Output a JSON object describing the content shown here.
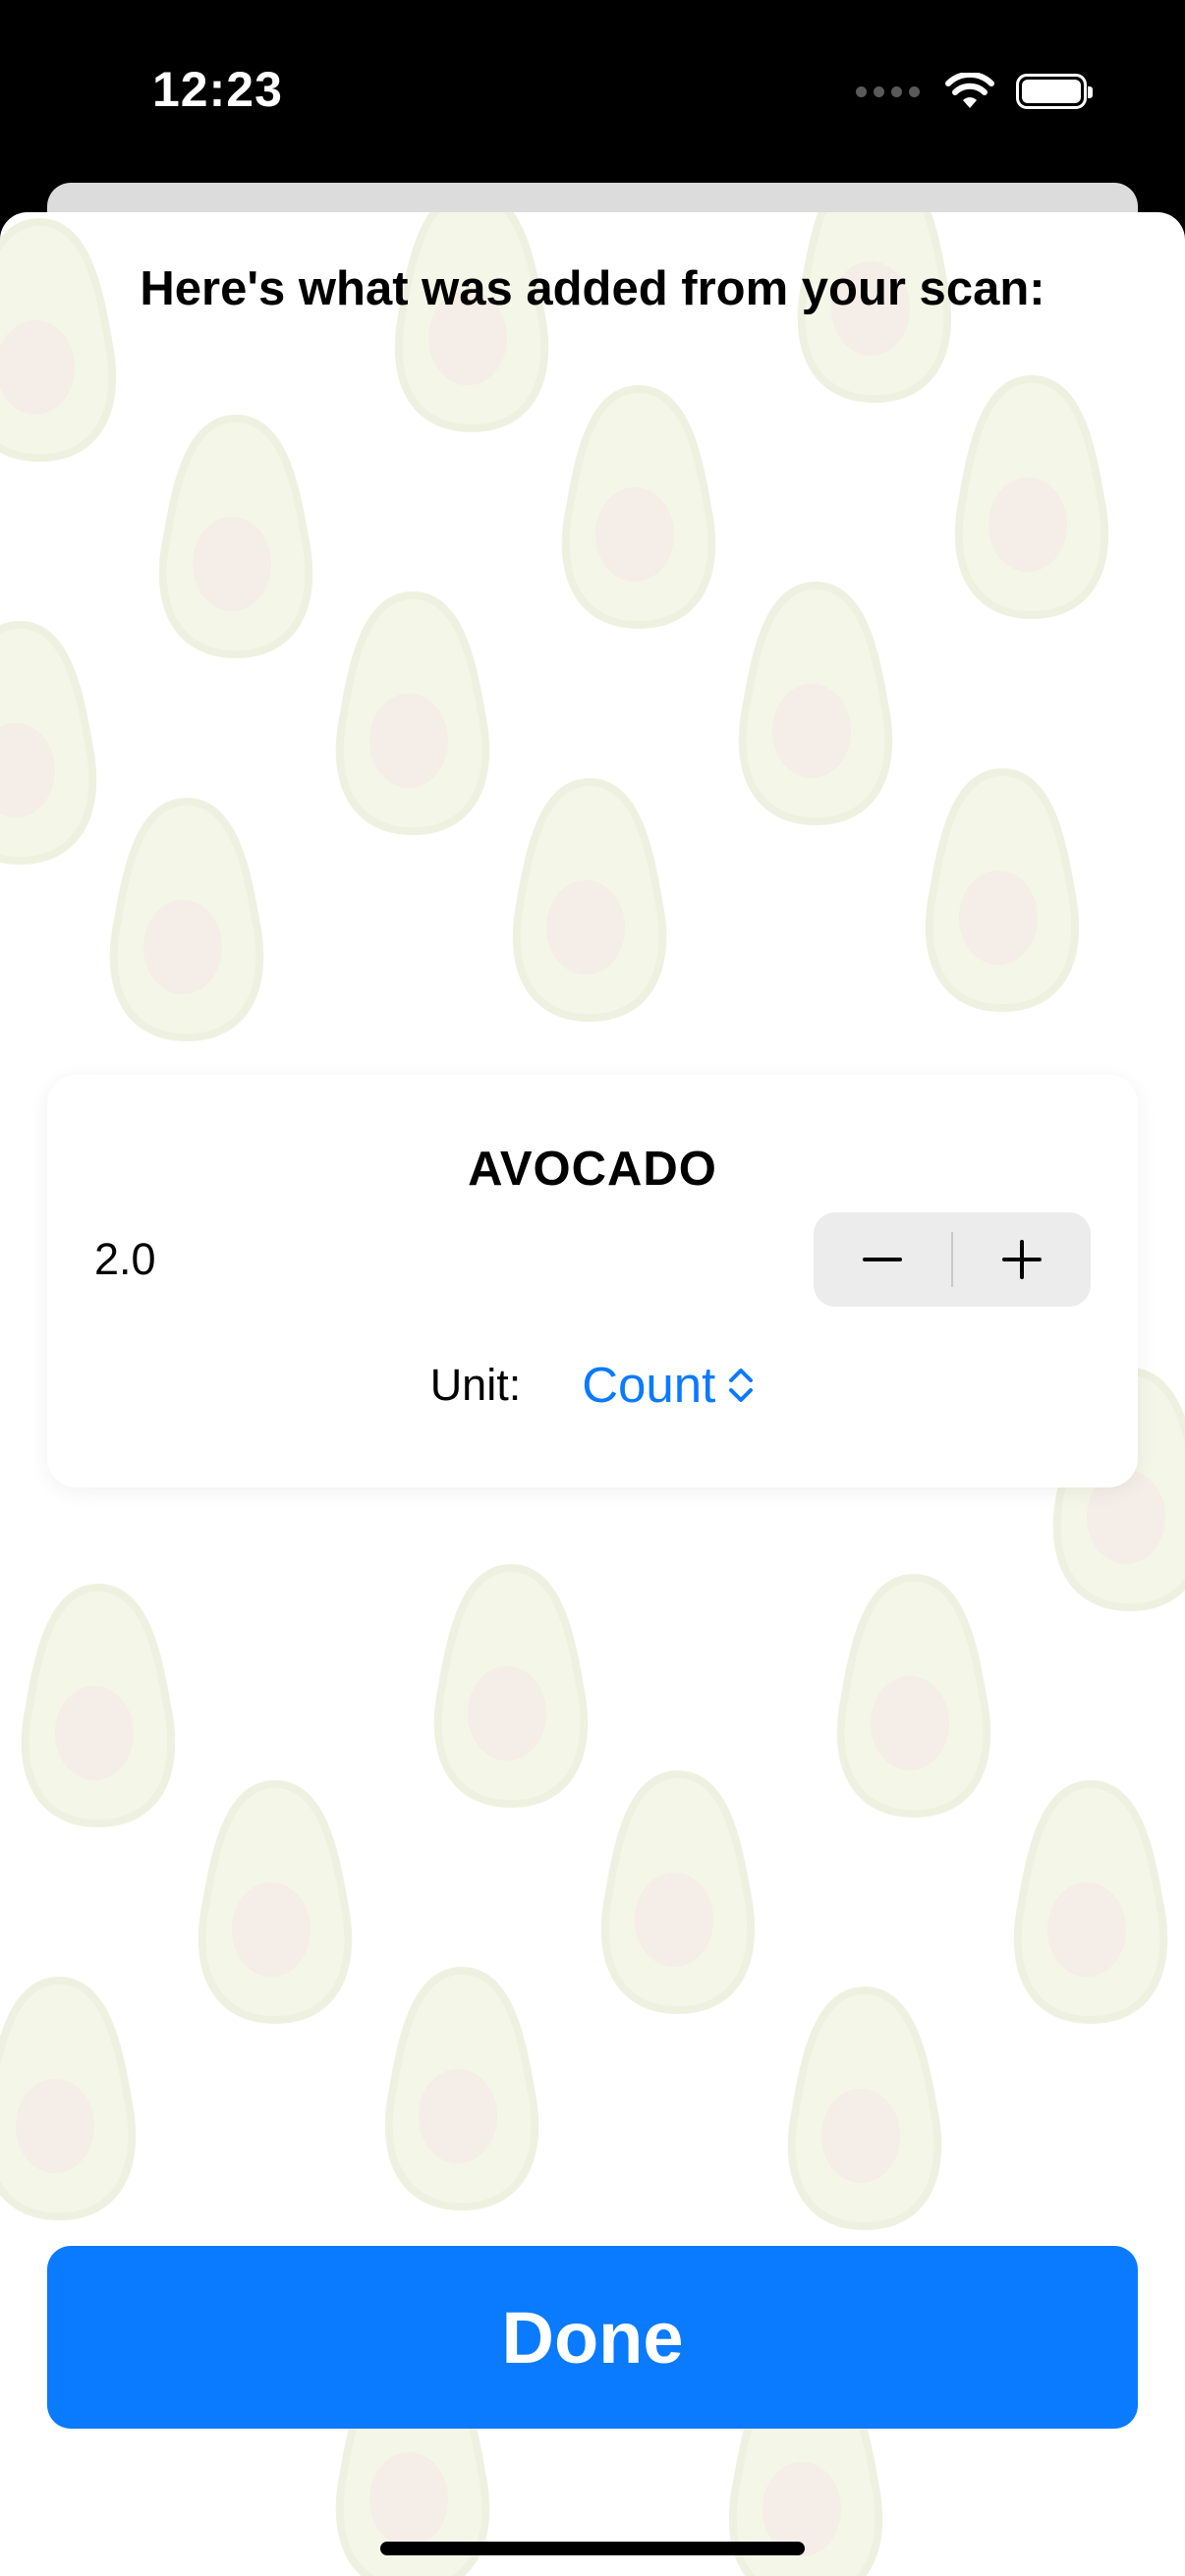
{
  "status_bar": {
    "time": "12:23",
    "icons": [
      "cellular-dots-icon",
      "wifi-icon",
      "battery-icon"
    ]
  },
  "sheet": {
    "title": "Here's what was added from your scan:",
    "background": "avocado-pattern"
  },
  "item": {
    "name": "AVOCADO",
    "quantity": "2.0",
    "unit_label": "Unit:",
    "unit_value": "Count",
    "stepper": {
      "decrement": "minus-icon",
      "increment": "plus-icon"
    }
  },
  "actions": {
    "done_label": "Done"
  },
  "colors": {
    "accent": "#0A7AFF",
    "card": "#FFFFFF",
    "stepper_bg": "#ECECEC"
  }
}
